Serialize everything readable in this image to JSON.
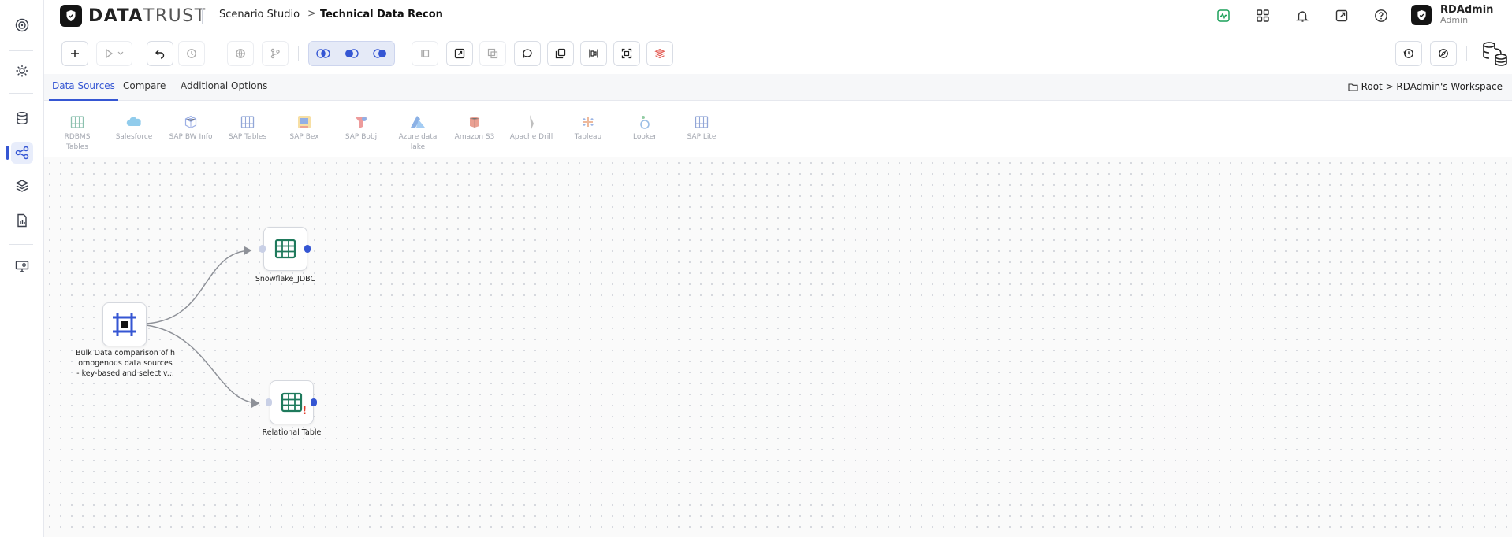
{
  "header": {
    "logo_bold": "DATA",
    "logo_light": "TRUST",
    "breadcrumb_studio": "Scenario Studio",
    "breadcrumb_chevron": ">",
    "breadcrumb_scenario": "Technical Data Recon",
    "user_name": "RDAdmin",
    "user_role": "Admin"
  },
  "tabs": [
    {
      "label": "Data Sources",
      "active": true
    },
    {
      "label": "Compare",
      "active": false
    },
    {
      "label": "Additional Options",
      "active": false
    }
  ],
  "workspace_path": "Root > RDAdmin's Workspace",
  "data_sources": [
    {
      "label": "RDBMS Tables",
      "icon": "table-icon"
    },
    {
      "label": "Salesforce",
      "icon": "cloud-icon"
    },
    {
      "label": "SAP BW Info",
      "icon": "cube-icon"
    },
    {
      "label": "SAP Tables",
      "icon": "table-icon"
    },
    {
      "label": "SAP Bex",
      "icon": "bex-icon"
    },
    {
      "label": "SAP Bobj",
      "icon": "bobj-icon"
    },
    {
      "label": "Azure data lake",
      "icon": "azure-icon"
    },
    {
      "label": "Amazon S3",
      "icon": "s3-icon"
    },
    {
      "label": "Apache Drill",
      "icon": "drill-icon"
    },
    {
      "label": "Tableau",
      "icon": "tableau-icon"
    },
    {
      "label": "Looker",
      "icon": "looker-icon"
    },
    {
      "label": "SAP Lite",
      "icon": "table-icon"
    }
  ],
  "canvas": {
    "nodes": [
      {
        "id": "bulk",
        "label_lines": [
          "Bulk Data comparison of h",
          "omogenous data sources",
          "- key-based and selectiv..."
        ]
      },
      {
        "id": "snowflake",
        "label_lines": [
          "Snowflake_JDBC"
        ]
      },
      {
        "id": "relational",
        "label_lines": [
          "Relational Table"
        ],
        "warning": "!"
      }
    ]
  },
  "colors": {
    "accent": "#3556d3",
    "node_green": "#1f7a5c",
    "warning_red": "#e03a2a",
    "status_green": "#1ca05a"
  }
}
